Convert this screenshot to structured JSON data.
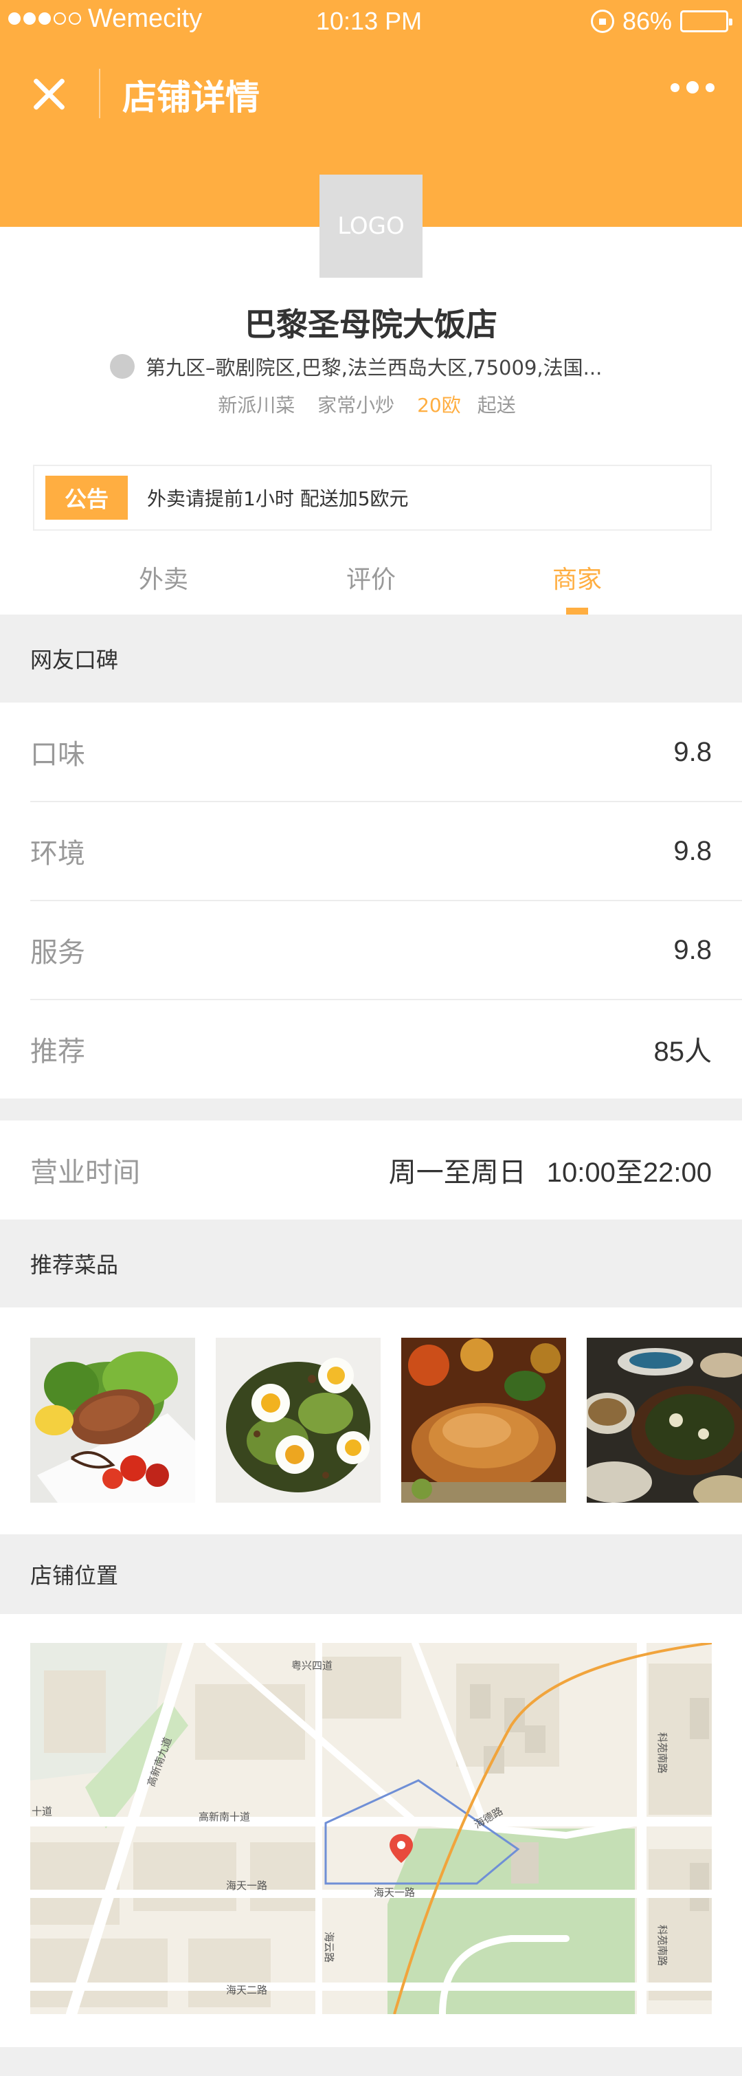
{
  "status_bar": {
    "carrier": "Wemecity",
    "time": "10:13 PM",
    "battery": "86%",
    "battery_level": 0.86
  },
  "nav": {
    "title": "店铺详情",
    "close_icon": "close-icon",
    "more_icon": "more-icon"
  },
  "shop": {
    "logo_text": "LOGO",
    "name": "巴黎圣母院大饭店",
    "address": "第九区–歌剧院区,巴黎,法兰西岛大区,75009,法国...",
    "tags": [
      "新派川菜",
      "家常小炒"
    ],
    "min_amount": "20欧",
    "min_suffix": "起送"
  },
  "notice": {
    "badge": "公告",
    "text": "外卖请提前1小时 配送加5欧元"
  },
  "tabs": [
    {
      "label": "外卖",
      "active": false
    },
    {
      "label": "评价",
      "active": false
    },
    {
      "label": "商家",
      "active": true
    }
  ],
  "reviews": {
    "title": "网友口碑",
    "rows": [
      {
        "label": "口味",
        "value": "9.8"
      },
      {
        "label": "环境",
        "value": "9.8"
      },
      {
        "label": "服务",
        "value": "9.8"
      },
      {
        "label": "推荐",
        "value": "85人"
      }
    ]
  },
  "hours": {
    "label": "营业时间",
    "days": "周一至周日",
    "time": "10:00至22:00"
  },
  "dishes": {
    "title": "推荐菜品"
  },
  "location": {
    "title": "店铺位置",
    "map_labels": [
      "粤兴四道",
      "高新南十道",
      "高新南九道",
      "海天一路",
      "海天一路",
      "海天二路",
      "海云路",
      "海德路",
      "科苑南路",
      "科苑南路",
      "十道"
    ]
  },
  "colors": {
    "accent": "#ffae41",
    "background": "#efefef"
  }
}
